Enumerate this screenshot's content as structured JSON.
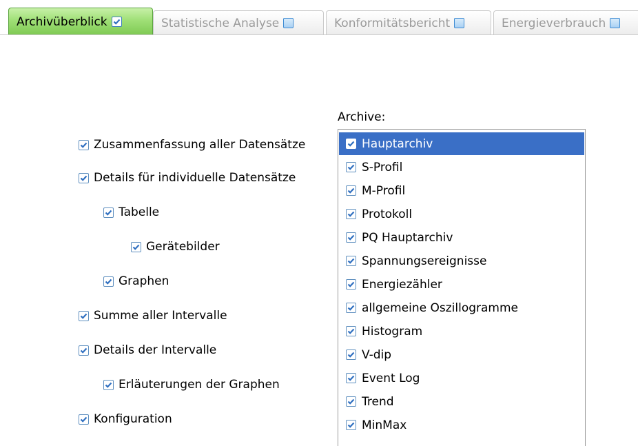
{
  "tabs": [
    {
      "label": "Archivüberblick",
      "active": true,
      "checked": true
    },
    {
      "label": "Statistische Analyse",
      "active": false,
      "checked": false
    },
    {
      "label": "Konformitätsbericht",
      "active": false,
      "checked": false
    },
    {
      "label": "Energieverbrauch",
      "active": false,
      "checked": false
    }
  ],
  "options": [
    {
      "label": "Zusammenfassung aller Datensätze",
      "checked": true
    },
    {
      "label": "Details für individuelle Datensätze",
      "checked": true
    },
    {
      "label": "Tabelle",
      "checked": true
    },
    {
      "label": "Gerätebilder",
      "checked": true
    },
    {
      "label": "Graphen",
      "checked": true
    },
    {
      "label": "Summe aller Intervalle",
      "checked": true
    },
    {
      "label": "Details der Intervalle",
      "checked": true
    },
    {
      "label": "Erläuterungen der Graphen",
      "checked": true
    },
    {
      "label": "Konfiguration",
      "checked": true
    }
  ],
  "archives": {
    "title": "Archive:",
    "items": [
      {
        "label": "Hauptarchiv",
        "checked": true,
        "selected": true
      },
      {
        "label": "S-Profil",
        "checked": true
      },
      {
        "label": "M-Profil",
        "checked": true
      },
      {
        "label": "Protokoll",
        "checked": true
      },
      {
        "label": "PQ Hauptarchiv",
        "checked": true
      },
      {
        "label": "Spannungsereignisse",
        "checked": true
      },
      {
        "label": "Energiezähler",
        "checked": true
      },
      {
        "label": "allgemeine Oszillogramme",
        "checked": true
      },
      {
        "label": "Histogram",
        "checked": true
      },
      {
        "label": "V-dip",
        "checked": true
      },
      {
        "label": "Event Log",
        "checked": true
      },
      {
        "label": "Trend",
        "checked": true
      },
      {
        "label": "MinMax",
        "checked": true
      }
    ]
  },
  "colors": {
    "active_tab": "#9fdf76",
    "selection": "#3a6fc6",
    "checkmark": "#2f6fc0"
  }
}
